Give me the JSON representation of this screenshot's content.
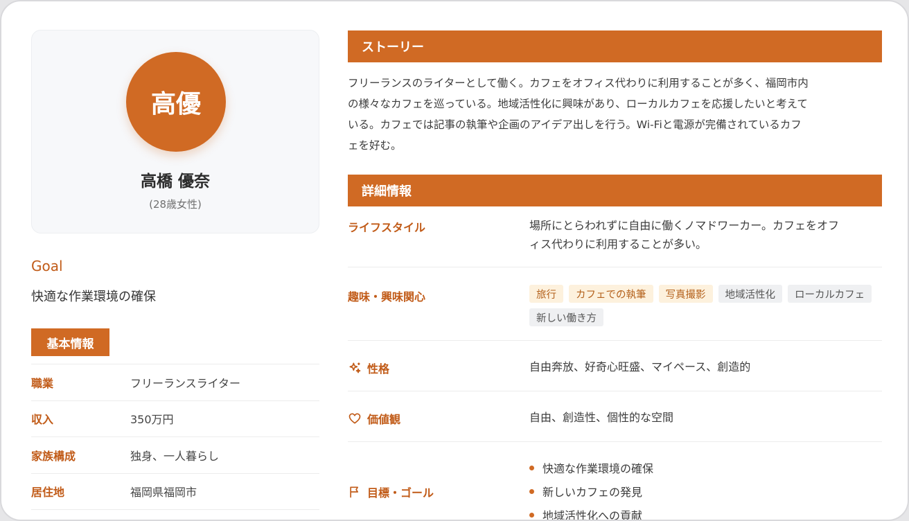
{
  "profile": {
    "avatar_initials": "高優",
    "name": "高橋 優奈",
    "age": "(28歳女性)"
  },
  "goal": {
    "title": "Goal",
    "text": "快適な作業環境の確保"
  },
  "basic_info": {
    "header": "基本情報",
    "rows": [
      {
        "label": "職業",
        "value": "フリーランスライター"
      },
      {
        "label": "収入",
        "value": "350万円"
      },
      {
        "label": "家族構成",
        "value": "独身、一人暮らし"
      },
      {
        "label": "居住地",
        "value": "福岡県福岡市"
      }
    ]
  },
  "story": {
    "header": "ストーリー",
    "lines": [
      "フリーランスのライターとして働く。カフェをオフィス代わりに利用することが多く、福岡市内",
      "の様々なカフェを巡っている。地域活性化に興味があり、ローカルカフェを応援したいと考えて",
      "いる。カフェでは記事の執筆や企画のアイデア出しを行う。Wi-Fiと電源が完備されているカフ",
      "ェを好む。"
    ]
  },
  "details": {
    "header": "詳細情報",
    "lifestyle": {
      "label": "ライフスタイル",
      "lines": [
        "場所にとらわれずに自由に働くノマドワーカー。カフェをオフ",
        "ィス代わりに利用することが多い。"
      ]
    },
    "interests": {
      "label": "趣味・興味関心",
      "tags": [
        {
          "text": "旅行",
          "style": "warm"
        },
        {
          "text": "カフェでの執筆",
          "style": "warm"
        },
        {
          "text": "写真撮影",
          "style": "warm"
        },
        {
          "text": "地域活性化",
          "style": "gray"
        },
        {
          "text": "ローカルカフェ",
          "style": "gray"
        },
        {
          "text": "新しい働き方",
          "style": "gray"
        }
      ]
    },
    "personality": {
      "label": "性格",
      "icon": "sparkles-icon",
      "value": "自由奔放、好奇心旺盛、マイペース、創造的"
    },
    "values": {
      "label": "価値観",
      "icon": "heart-icon",
      "value": "自由、創造性、個性的な空間"
    },
    "goals": {
      "label": "目標・ゴール",
      "icon": "flag-icon",
      "items": [
        "快適な作業環境の確保",
        "新しいカフェの発見",
        "地域活性化への貢献"
      ]
    }
  },
  "colors": {
    "accent": "#d06a24",
    "accent_text": "#c15b18",
    "tag_warm_bg": "#fdf1dd",
    "tag_gray_bg": "#eff0f2"
  }
}
